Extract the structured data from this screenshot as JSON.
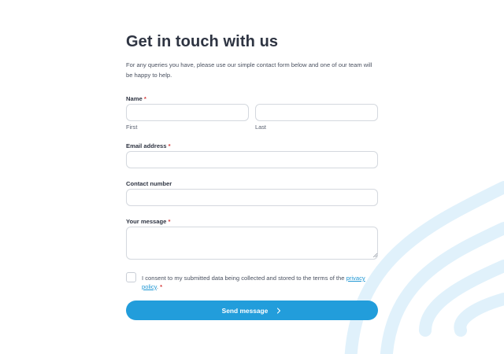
{
  "form": {
    "title": "Get in touch with us",
    "intro": "For any queries you have, please use our simple contact form below and one of our team will be happy to help.",
    "name": {
      "label": "Name",
      "required_mark": "*",
      "first_value": "",
      "first_sublabel": "First",
      "last_value": "",
      "last_sublabel": "Last"
    },
    "email": {
      "label": "Email address",
      "required_mark": "*",
      "value": ""
    },
    "contact": {
      "label": "Contact number",
      "value": ""
    },
    "message": {
      "label": "Your message",
      "required_mark": "*",
      "value": ""
    },
    "consent": {
      "checked": false,
      "text_before": "I consent to my submitted data being collected and stored to the terms of the ",
      "link_text": "privacy policy",
      "text_after": ".",
      "required_mark": "*"
    },
    "submit_label": "Send message",
    "submit_icon": "chevron-right-icon"
  },
  "colors": {
    "accent": "#229ddb",
    "link": "#1f97d4",
    "required": "#d63b3b",
    "background_wave": "#dff0fb"
  }
}
